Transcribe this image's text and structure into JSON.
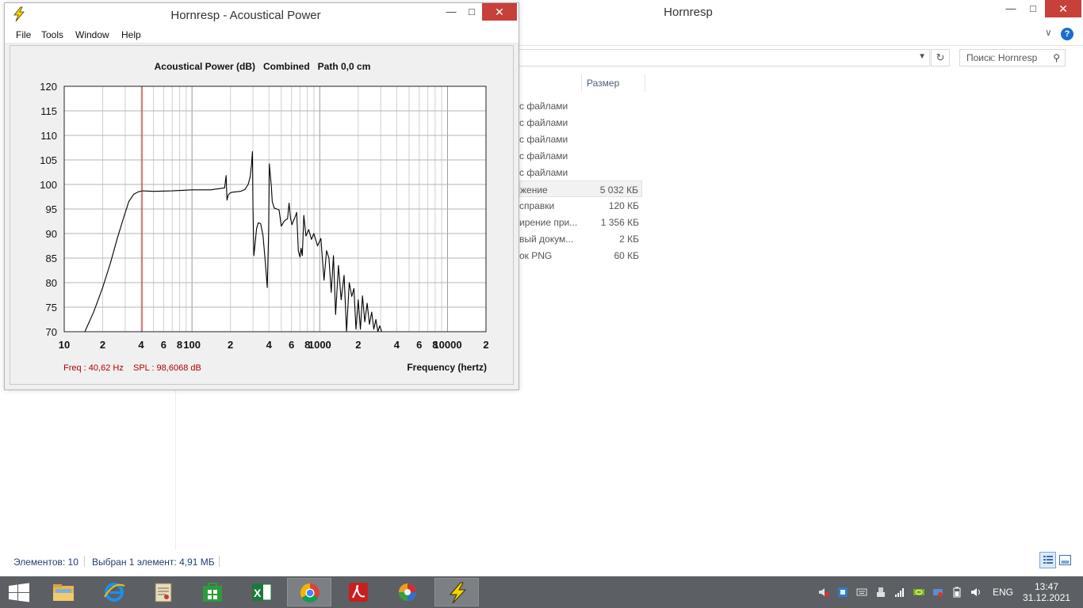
{
  "explorer": {
    "title": "Hornresp",
    "search_placeholder": "Поиск: Hornresp",
    "column_size": "Размер",
    "rows": [
      {
        "type": "с файлами",
        "size": ""
      },
      {
        "type": "с файлами",
        "size": ""
      },
      {
        "type": "с файлами",
        "size": ""
      },
      {
        "type": "с файлами",
        "size": ""
      },
      {
        "type": "с файлами",
        "size": ""
      },
      {
        "type": "жение",
        "size": "5 032 КБ",
        "selected": true
      },
      {
        "type": "справки",
        "size": "120 КБ"
      },
      {
        "type": "ирение при...",
        "size": "1 356 КБ"
      },
      {
        "type": "вый докум...",
        "size": "2 КБ"
      },
      {
        "type": "ок PNG",
        "size": "60 КБ"
      }
    ],
    "status_count": "Элементов: 10",
    "status_selected": "Выбран 1 элемент: 4,91 МБ"
  },
  "hornresp": {
    "title": "Hornresp - Acoustical Power",
    "menu": [
      "File",
      "Tools",
      "Window",
      "Help"
    ]
  },
  "chart_data": {
    "type": "line",
    "title": "Acoustical Power (dB)   Combined   Path 0,0 cm",
    "xlabel": "Frequency (hertz)",
    "x_scale": "log",
    "xlim": [
      10,
      20000
    ],
    "ylim": [
      70,
      120
    ],
    "y_ticks": [
      120,
      115,
      110,
      105,
      100,
      95,
      90,
      85,
      80,
      75,
      70
    ],
    "x_tick_labels": [
      {
        "v": 10,
        "t": "10"
      },
      {
        "v": 20,
        "t": "2"
      },
      {
        "v": 40,
        "t": "4"
      },
      {
        "v": 60,
        "t": "6"
      },
      {
        "v": 80,
        "t": "8"
      },
      {
        "v": 100,
        "t": "100"
      },
      {
        "v": 200,
        "t": "2"
      },
      {
        "v": 400,
        "t": "4"
      },
      {
        "v": 600,
        "t": "6"
      },
      {
        "v": 800,
        "t": "8"
      },
      {
        "v": 1000,
        "t": "1000"
      },
      {
        "v": 2000,
        "t": "2"
      },
      {
        "v": 4000,
        "t": "4"
      },
      {
        "v": 6000,
        "t": "6"
      },
      {
        "v": 8000,
        "t": "8"
      },
      {
        "v": 10000,
        "t": "10000"
      },
      {
        "v": 20000,
        "t": "2"
      }
    ],
    "cursor": {
      "freq": 40.62,
      "spl": 98.6068
    },
    "readout_freq": "Freq : 40,62 Hz",
    "readout_spl": "SPL : 98,6068 dB",
    "grid": true,
    "line_color": "#000000",
    "cursor_color": "#d01010",
    "series": [
      {
        "x": [
          14.5,
          17,
          20,
          23,
          26,
          29,
          32,
          35,
          38,
          41,
          50,
          70,
          100,
          140,
          180,
          185,
          188,
          192,
          197,
          205,
          220,
          240,
          260,
          275,
          285,
          292,
          297,
          300,
          305,
          312,
          320,
          330,
          345,
          360,
          375,
          388,
          398,
          403,
          410,
          418,
          425,
          440,
          460,
          480,
          500,
          520,
          540,
          560,
          575,
          590,
          605,
          620,
          640,
          660,
          680,
          700,
          715,
          730,
          750,
          780,
          820,
          860,
          900,
          960,
          1020,
          1080,
          1130,
          1180,
          1230,
          1280,
          1330,
          1400,
          1470,
          1550,
          1620,
          1700,
          1780,
          1850,
          1920,
          2000,
          2080,
          2160,
          2250,
          2350,
          2450,
          2550,
          2650,
          2750,
          2850,
          2950,
          3050
        ],
        "y": [
          70,
          74,
          79,
          84,
          89,
          93,
          96.5,
          98,
          98.5,
          98.7,
          98.6,
          98.7,
          98.9,
          98.9,
          99.3,
          101.8,
          96.8,
          97.8,
          98.2,
          98.4,
          98.5,
          98.6,
          99,
          100,
          101.5,
          104,
          106.7,
          95,
          85.5,
          88,
          91,
          92.2,
          92,
          89.5,
          84,
          79,
          90,
          104.2,
          102,
          99.5,
          96.5,
          95.2,
          95,
          94.8,
          91.5,
          92.3,
          92.8,
          93,
          96.2,
          93.2,
          91.8,
          92.5,
          93.3,
          94.3,
          86.5,
          85.2,
          87,
          85.5,
          93.7,
          89.5,
          90.8,
          88.8,
          90,
          87.5,
          89,
          80.5,
          86.5,
          85,
          78,
          85.5,
          73.5,
          83.5,
          76.5,
          81.5,
          70,
          80,
          77.2,
          78.8,
          70.5,
          76.5,
          70.5,
          77.3,
          72,
          75.8,
          71.5,
          74,
          70.5,
          72.5,
          70,
          71.2,
          70
        ]
      }
    ]
  }
}
